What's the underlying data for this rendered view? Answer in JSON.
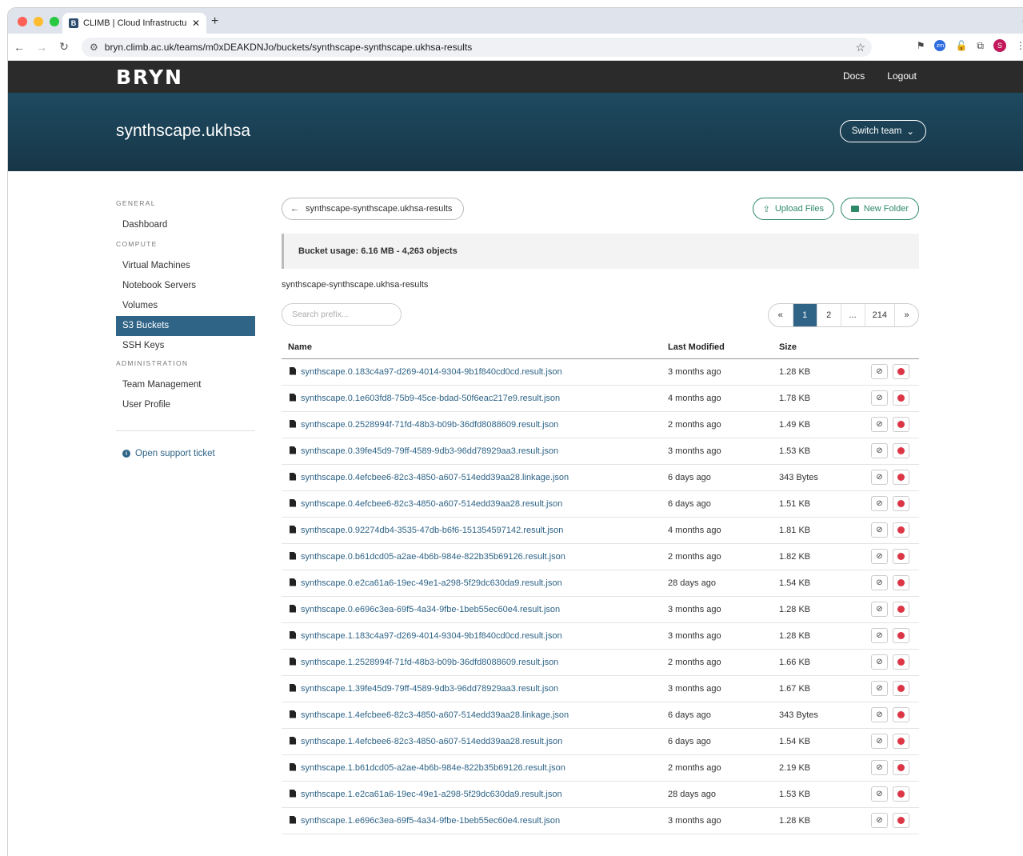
{
  "browser": {
    "tab_title": "CLIMB | Cloud Infrastructure",
    "tab_favicon": "B",
    "url": "bryn.climb.ac.uk/teams/m0xDEAKDNJo/buckets/synthscape-synthscape.ukhsa-results",
    "profile_initial": "S"
  },
  "header": {
    "logo": "BRYN",
    "docs": "Docs",
    "logout": "Logout",
    "team": "synthscape.ukhsa",
    "switch_team": "Switch team"
  },
  "sidebar": {
    "general": "GENERAL",
    "dashboard": "Dashboard",
    "compute": "COMPUTE",
    "vms": "Virtual Machines",
    "notebooks": "Notebook Servers",
    "volumes": "Volumes",
    "s3": "S3 Buckets",
    "ssh": "SSH Keys",
    "administration": "ADMINISTRATION",
    "team_management": "Team Management",
    "user_profile": "User Profile",
    "support": "Open support ticket"
  },
  "main": {
    "back_label": "synthscape-synthscape.ukhsa-results",
    "upload": "Upload Files",
    "new_folder": "New Folder",
    "usage": "Bucket usage: 6.16 MB - 4,263 objects",
    "path": "synthscape-synthscape.ukhsa-results",
    "search_placeholder": "Search prefix...",
    "pager": [
      "«",
      "1",
      "2",
      "...",
      "214",
      "»"
    ],
    "current_page": "1",
    "columns": {
      "name": "Name",
      "modified": "Last Modified",
      "size": "Size"
    },
    "files": [
      {
        "name": "synthscape.0.183c4a97-d269-4014-9304-9b1f840cd0cd.result.json",
        "modified": "3 months ago",
        "size": "1.28 KB"
      },
      {
        "name": "synthscape.0.1e603fd8-75b9-45ce-bdad-50f6eac217e9.result.json",
        "modified": "4 months ago",
        "size": "1.78 KB"
      },
      {
        "name": "synthscape.0.2528994f-71fd-48b3-b09b-36dfd8088609.result.json",
        "modified": "2 months ago",
        "size": "1.49 KB"
      },
      {
        "name": "synthscape.0.39fe45d9-79ff-4589-9db3-96dd78929aa3.result.json",
        "modified": "3 months ago",
        "size": "1.53 KB"
      },
      {
        "name": "synthscape.0.4efcbee6-82c3-4850-a607-514edd39aa28.linkage.json",
        "modified": "6 days ago",
        "size": "343 Bytes"
      },
      {
        "name": "synthscape.0.4efcbee6-82c3-4850-a607-514edd39aa28.result.json",
        "modified": "6 days ago",
        "size": "1.51 KB"
      },
      {
        "name": "synthscape.0.92274db4-3535-47db-b6f6-151354597142.result.json",
        "modified": "4 months ago",
        "size": "1.81 KB"
      },
      {
        "name": "synthscape.0.b61dcd05-a2ae-4b6b-984e-822b35b69126.result.json",
        "modified": "2 months ago",
        "size": "1.82 KB"
      },
      {
        "name": "synthscape.0.e2ca61a6-19ec-49e1-a298-5f29dc630da9.result.json",
        "modified": "28 days ago",
        "size": "1.54 KB"
      },
      {
        "name": "synthscape.0.e696c3ea-69f5-4a34-9fbe-1beb55ec60e4.result.json",
        "modified": "3 months ago",
        "size": "1.28 KB"
      },
      {
        "name": "synthscape.1.183c4a97-d269-4014-9304-9b1f840cd0cd.result.json",
        "modified": "3 months ago",
        "size": "1.28 KB"
      },
      {
        "name": "synthscape.1.2528994f-71fd-48b3-b09b-36dfd8088609.result.json",
        "modified": "2 months ago",
        "size": "1.66 KB"
      },
      {
        "name": "synthscape.1.39fe45d9-79ff-4589-9db3-96dd78929aa3.result.json",
        "modified": "3 months ago",
        "size": "1.67 KB"
      },
      {
        "name": "synthscape.1.4efcbee6-82c3-4850-a607-514edd39aa28.linkage.json",
        "modified": "6 days ago",
        "size": "343 Bytes"
      },
      {
        "name": "synthscape.1.4efcbee6-82c3-4850-a607-514edd39aa28.result.json",
        "modified": "6 days ago",
        "size": "1.54 KB"
      },
      {
        "name": "synthscape.1.b61dcd05-a2ae-4b6b-984e-822b35b69126.result.json",
        "modified": "2 months ago",
        "size": "2.19 KB"
      },
      {
        "name": "synthscape.1.e2ca61a6-19ec-49e1-a298-5f29dc630da9.result.json",
        "modified": "28 days ago",
        "size": "1.53 KB"
      },
      {
        "name": "synthscape.1.e696c3ea-69f5-4a34-9fbe-1beb55ec60e4.result.json",
        "modified": "3 months ago",
        "size": "1.28 KB"
      }
    ]
  },
  "icons": {
    "back": "arrow-left-icon",
    "upload": "upload-icon",
    "folder": "folder-icon",
    "file": "file-icon",
    "link": "link-icon",
    "delete": "delete-dot-icon",
    "info": "info-icon"
  },
  "colors": {
    "accent": "#2f6487",
    "green": "#2e8a66",
    "danger": "#dc3545",
    "navbar": "#2b2b2b",
    "hero": "#1e4a60"
  }
}
